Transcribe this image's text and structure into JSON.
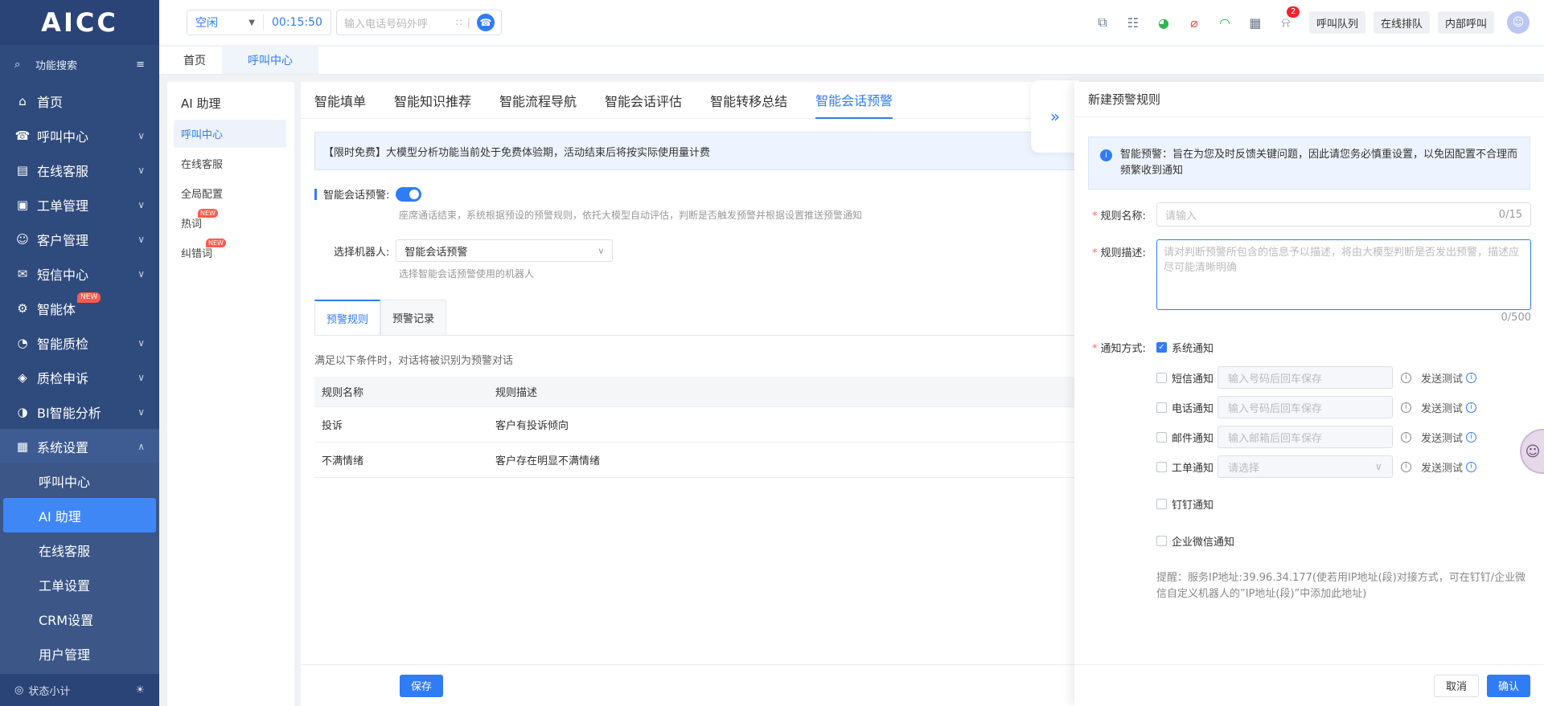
{
  "sidebar": {
    "logo": "AICC",
    "search_label": "功能搜索",
    "items": [
      {
        "label": "首页",
        "icon": "home-icon",
        "chev": false
      },
      {
        "label": "呼叫中心",
        "icon": "phone-icon",
        "chev": true
      },
      {
        "label": "在线客服",
        "icon": "chat-icon",
        "chev": true
      },
      {
        "label": "工单管理",
        "icon": "clipboard-icon",
        "chev": true
      },
      {
        "label": "客户管理",
        "icon": "users-icon",
        "chev": true
      },
      {
        "label": "短信中心",
        "icon": "mail-icon",
        "chev": true
      },
      {
        "label": "智能体",
        "icon": "robot-icon",
        "chev": false,
        "badge": "NEW"
      },
      {
        "label": "智能质检",
        "icon": "quality-icon",
        "chev": true
      },
      {
        "label": "质检申诉",
        "icon": "shield-icon",
        "chev": true
      },
      {
        "label": "BI智能分析",
        "icon": "pie-chart-icon",
        "chev": true
      }
    ],
    "open_item": {
      "label": "系统设置",
      "icon": "dashboard-icon"
    },
    "sub_items": [
      "呼叫中心",
      "AI 助理",
      "在线客服",
      "工单设置",
      "CRM设置",
      "用户管理"
    ],
    "footer_label": "状态小计"
  },
  "topbar": {
    "status": "空闲",
    "timer": "00:15:50",
    "dial_placeholder": "输入电话号码外呼",
    "badge_count": "2",
    "buttons": [
      "呼叫队列",
      "在线排队",
      "内部呼叫"
    ]
  },
  "page_tabs": [
    "首页",
    "呼叫中心"
  ],
  "sub_sidebar": {
    "heading": "AI 助理",
    "items": [
      {
        "label": "呼叫中心",
        "badge": ""
      },
      {
        "label": "在线客服",
        "badge": ""
      },
      {
        "label": "全局配置",
        "badge": ""
      },
      {
        "label": "热词",
        "badge": "NEW"
      },
      {
        "label": "纠错词",
        "badge": "NEW"
      }
    ]
  },
  "main": {
    "feature_tabs": [
      "智能填单",
      "智能知识推荐",
      "智能流程导航",
      "智能会话评估",
      "智能转移总结",
      "智能会话预警"
    ],
    "notice": "【限时免费】大模型分析功能当前处于免费体验期，活动结束后将按实际使用量计费",
    "warning_label": "智能会话预警:",
    "warning_hint": "座席通话结束，系统根据预设的预警规则，依托大模型自动评估，判断是否触发预警并根据设置推送预警通知",
    "robot_label": "选择机器人:",
    "robot_value": "智能会话预警",
    "robot_hint": "选择智能会话预警使用的机器人",
    "inner_tabs": [
      "预警规则",
      "预警记录"
    ],
    "condition_text": "满足以下条件时，对话将被识别为预警对话",
    "table": {
      "headers": [
        "规则名称",
        "规则描述"
      ],
      "rows": [
        [
          "投诉",
          "客户有投诉倾向"
        ],
        [
          "不满情绪",
          "客户存在明显不满情绪"
        ]
      ]
    },
    "save_label": "保存"
  },
  "drawer": {
    "title": "新建预警规则",
    "notice": "智能预警：旨在为您及时反馈关键问题，因此请您务必慎重设置，以免因配置不合理而频繁收到通知",
    "name_label": "规则名称:",
    "name_placeholder": "请输入",
    "name_counter": "0/15",
    "desc_label": "规则描述:",
    "desc_placeholder": "请对判断预警所包含的信息予以描述，将由大模型判断是否发出预警，描述应尽可能清晰明确",
    "desc_counter": "0/500",
    "notify_label": "通知方式:",
    "system_notify": "系统通知",
    "channels": [
      {
        "label": "短信通知",
        "placeholder": "输入号码后回车保存",
        "select": false
      },
      {
        "label": "电话通知",
        "placeholder": "输入号码后回车保存",
        "select": false
      },
      {
        "label": "邮件通知",
        "placeholder": "输入邮箱后回车保存",
        "select": false
      },
      {
        "label": "工单通知",
        "placeholder": "请选择",
        "select": true
      }
    ],
    "send_test": "发送测试",
    "dingtalk": "钉钉通知",
    "wecom": "企业微信通知",
    "tip": "提醒：服务IP地址:39.96.34.177(使若用IP地址(段)对接方式，可在钉钉/企业微信自定义机器人的”IP地址(段)”中添加此地址)",
    "cancel_label": "取消",
    "confirm_label": "确认"
  },
  "colors": {
    "primary": "#2f7cf6",
    "sidebar_bg": "#2f4a7d",
    "new_badge": "#ff5b4d"
  }
}
